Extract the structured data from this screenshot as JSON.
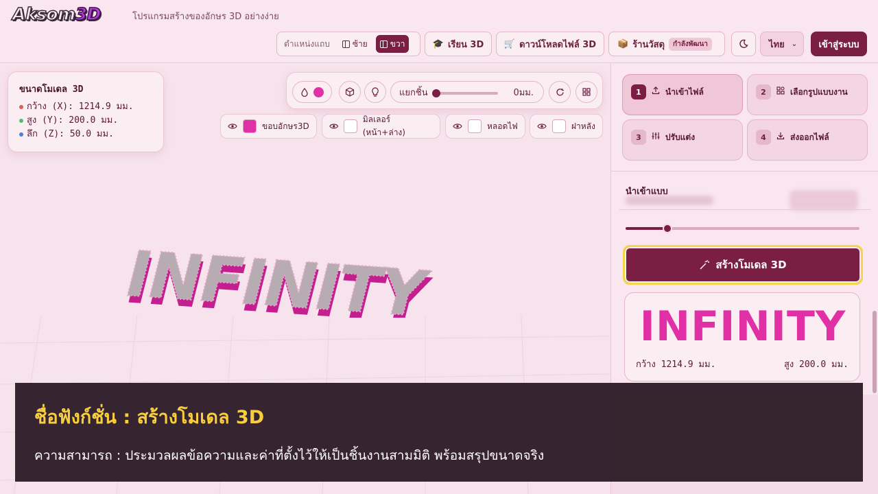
{
  "header": {
    "logo_main": "Aksom",
    "logo_accent": "3D",
    "tagline": "โปรแกรมสร้างของอักษร 3D อย่างง่าย",
    "position_label": "ตำแหน่งแถบ",
    "position_left": "ซ้าย",
    "position_right": "ขวา",
    "learn_label": "เรียน 3D",
    "download_label": "ดาวน์โหลดไฟล์ 3D",
    "shop_label": "ร้านวัสดุ",
    "shop_badge": "กำลังพัฒนา",
    "language": "ไทย",
    "login_label": "เข้าสู่ระบบ"
  },
  "size_card": {
    "title": "ขนาดโมเดล 3D",
    "rows": [
      {
        "text": "กว้าง (X): 1214.9 มม.",
        "color": "#e05a5a"
      },
      {
        "text": "สูง (Y): 200.0 มม.",
        "color": "#4fbf6a"
      },
      {
        "text": "ลึก (Z): 50.0 มม.",
        "color": "#4a7fe0"
      }
    ]
  },
  "toolbar": {
    "separate_label": "แยกชิ้น",
    "separate_value": "0มม.",
    "separate_fraction": 0.0
  },
  "layers": [
    {
      "label": "ขอบอักษร3D",
      "color": "#e12fa5"
    },
    {
      "label": "มิลเลอร์ (หน้า+ล่าง)",
      "color": "#ffffff"
    },
    {
      "label": "หลอดไฟ",
      "color": "#ffffff"
    },
    {
      "label": "ฝาหลัง",
      "color": "#ffffff"
    }
  ],
  "model": {
    "text": "INFINITY",
    "side_color": "#c41f8f",
    "face_color": "#a9a0a6"
  },
  "panel": {
    "steps": [
      {
        "num": "1",
        "label": "นำเข้าไฟล์"
      },
      {
        "num": "2",
        "label": "เลือกรูปแบบงาน"
      },
      {
        "num": "3",
        "label": "ปรับแต่ง"
      },
      {
        "num": "4",
        "label": "ส่งออกไฟล์"
      }
    ],
    "section_title": "นำเข้าแบบ",
    "slider_fraction": 0.18,
    "create_label": "สร้างโมเดล 3D",
    "preview_text": "INFINITY",
    "preview_width": "กว้าง 1214.9 มม.",
    "preview_height": "สูง 200.0 มม."
  },
  "caption": {
    "function_name": "ชื่อฟังก์ชั่น : สร้างโมเดล 3D",
    "description": "ความสามารถ : ประมวลผลข้อความและค่าที่ตั้งไว้ให้เป็นชิ้นงานสามมิติ พร้อมสรุปขนาดจริง"
  }
}
